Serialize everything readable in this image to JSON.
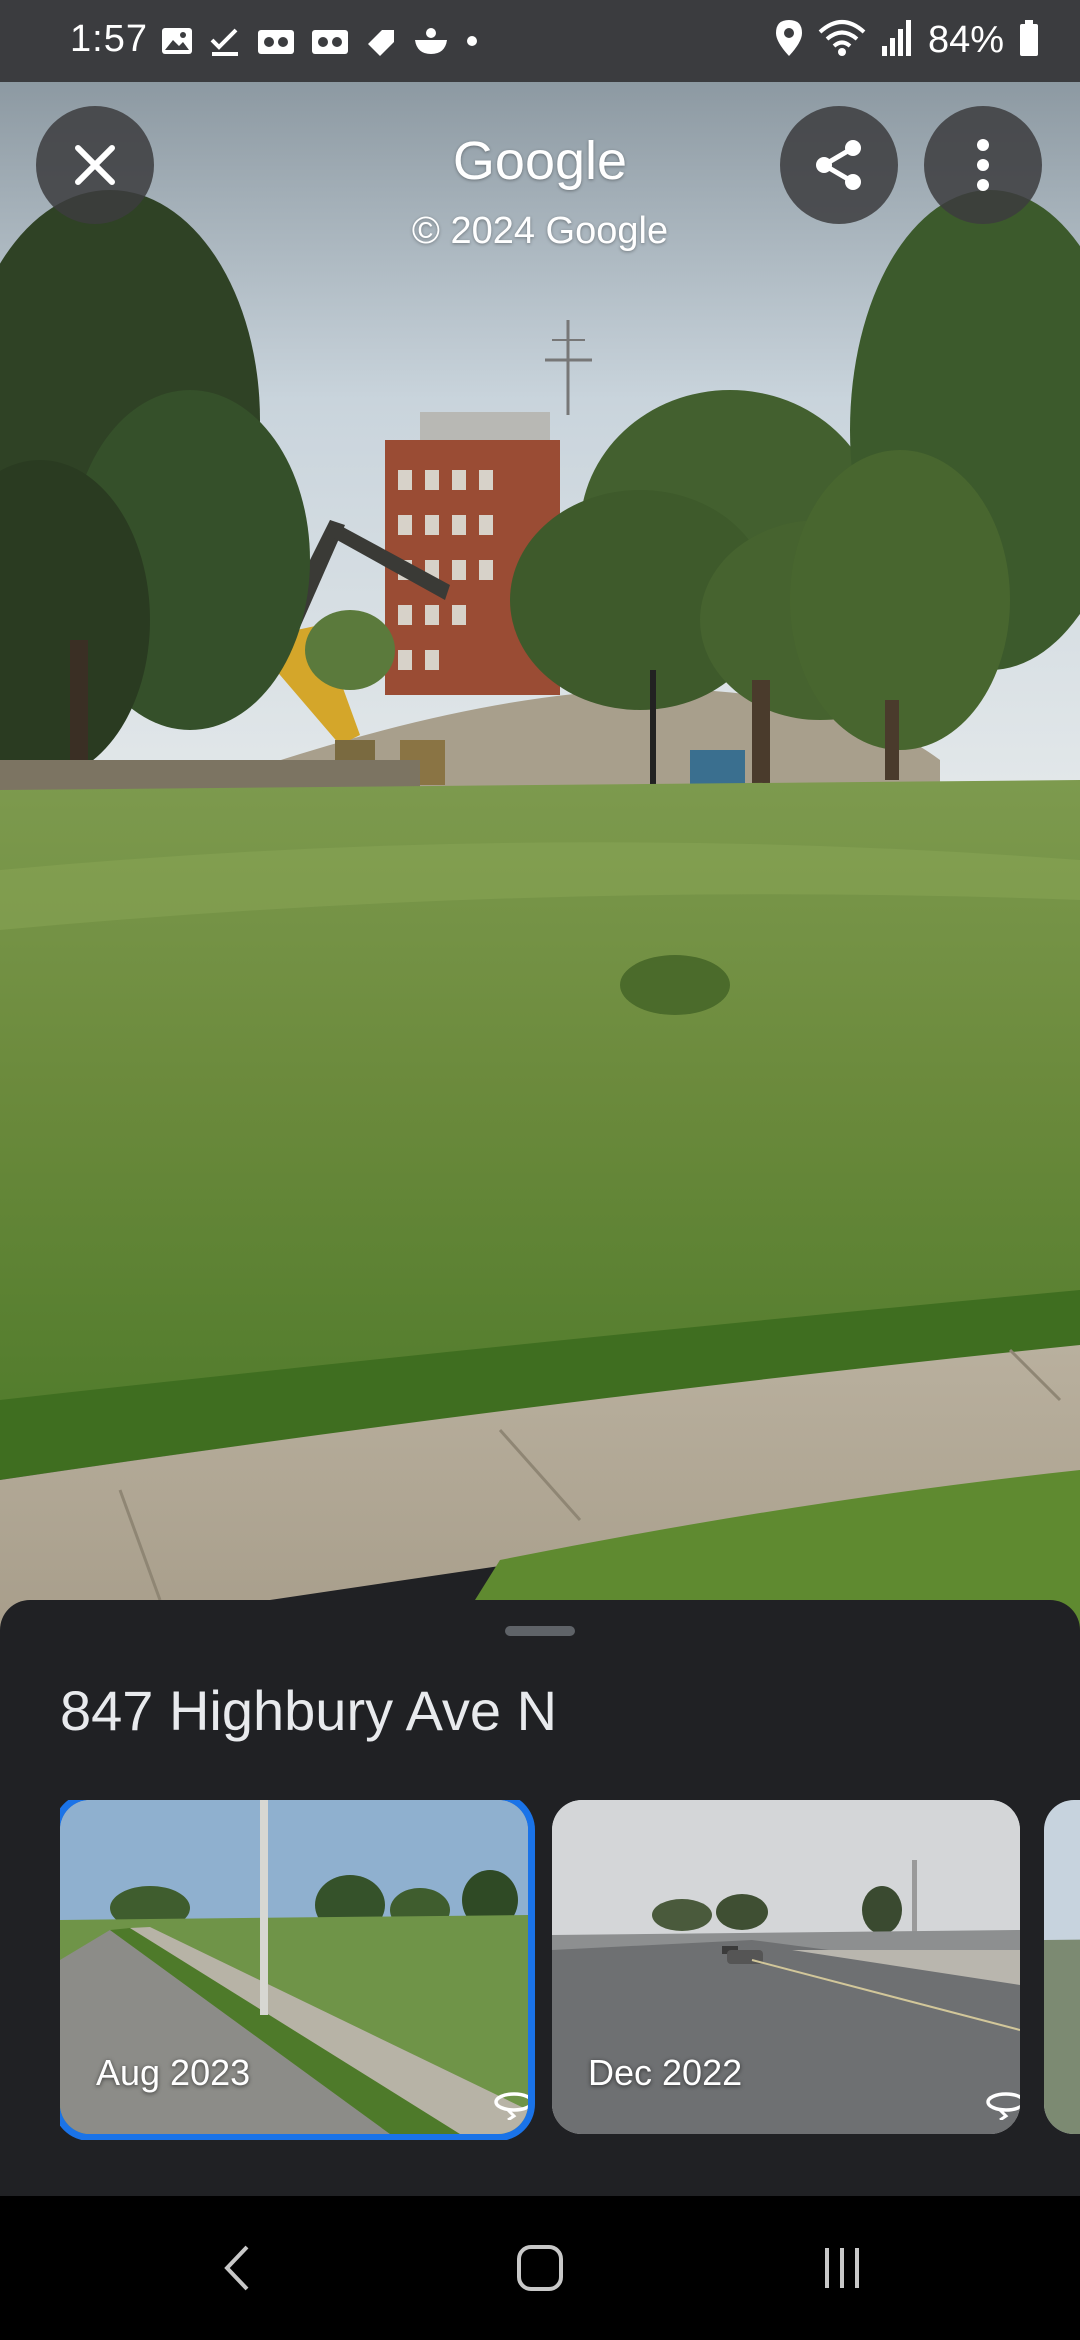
{
  "status_bar": {
    "time": "1:57",
    "battery": "84%",
    "left_icons": [
      "gallery-icon",
      "check-icon",
      "voicemail-icon",
      "voicemail-icon",
      "tag-icon",
      "food-icon",
      "dot-icon"
    ],
    "right_icons": [
      "location-icon",
      "wifi-icon",
      "signal-icon",
      "battery-icon"
    ]
  },
  "header": {
    "title": "Google",
    "copyright": "© 2024 Google"
  },
  "sheet": {
    "address": "847 Highbury Ave N",
    "cards": [
      {
        "date": "Aug 2023",
        "selected": true
      },
      {
        "date": "Dec 2022",
        "selected": false
      }
    ]
  },
  "colors": {
    "accent": "#1a73e8",
    "sheet_bg": "#202124",
    "status_bg": "#3b3c3f"
  }
}
